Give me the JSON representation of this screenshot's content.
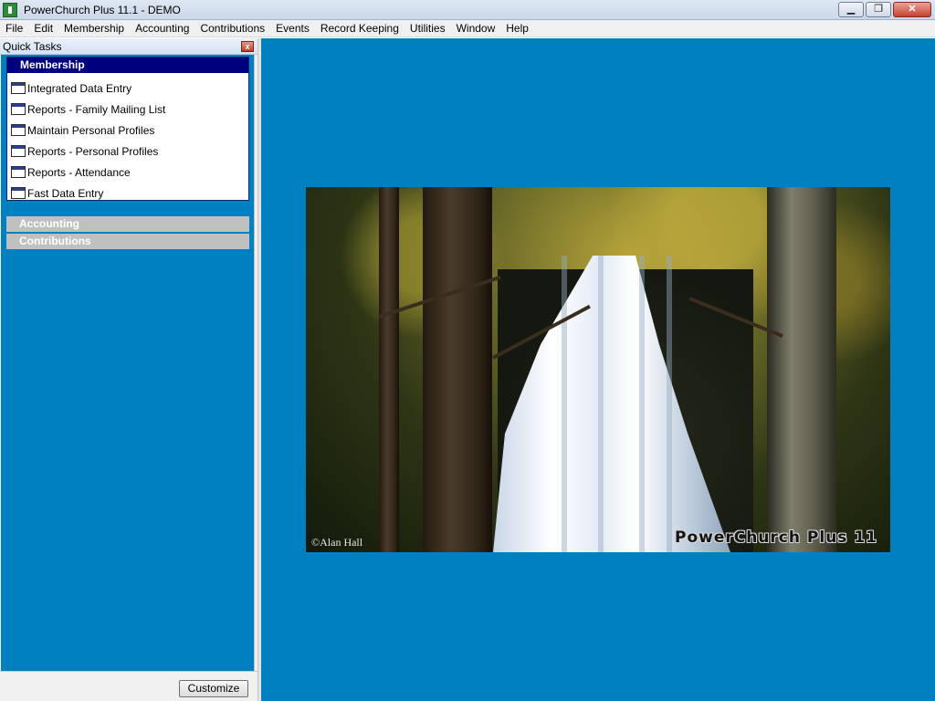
{
  "window": {
    "title": "PowerChurch Plus 11.1 - DEMO",
    "buttons": {
      "minimize": "▁",
      "restore": "❐",
      "close": "✕"
    }
  },
  "menu": [
    "File",
    "Edit",
    "Membership",
    "Accounting",
    "Contributions",
    "Events",
    "Record Keeping",
    "Utilities",
    "Window",
    "Help"
  ],
  "quick_tasks": {
    "title": "Quick Tasks",
    "close_glyph": "x",
    "groups": [
      {
        "name": "Membership",
        "expanded": true,
        "items": [
          "Integrated Data Entry",
          "Reports - Family Mailing List",
          "Maintain Personal Profiles",
          "Reports - Personal Profiles",
          "Reports - Attendance",
          "Fast Data Entry"
        ]
      },
      {
        "name": "Accounting",
        "expanded": false
      },
      {
        "name": "Contributions",
        "expanded": false
      }
    ],
    "customize_label": "Customize"
  },
  "splash": {
    "copyright": "©Alan Hall",
    "brand": "PowerChurch Plus 11"
  },
  "colors": {
    "desktop_blue": "#0080c0",
    "active_group": "#00007f",
    "collapsed_group": "#c0c0c0"
  },
  "icons": {
    "app": "powerchurch-app-icon",
    "task": "window-form-icon"
  }
}
